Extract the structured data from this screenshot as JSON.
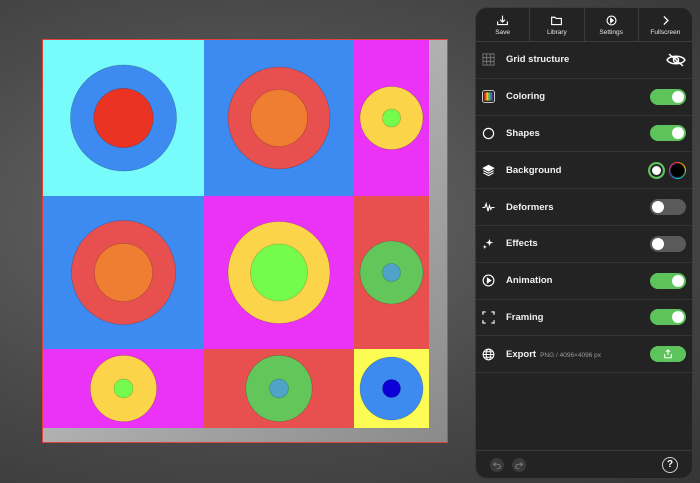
{
  "toolbar": {
    "save_label": "Save",
    "library_label": "Library",
    "settings_label": "Settings",
    "fullscreen_label": "Fullscreen"
  },
  "panel": {
    "grid_structure": {
      "label": "Grid structure",
      "icon": "grid-icon",
      "visible": false
    },
    "coloring": {
      "label": "Coloring",
      "icon": "palette-icon",
      "enabled": true
    },
    "shapes": {
      "label": "Shapes",
      "icon": "circle-icon",
      "enabled": true
    },
    "background": {
      "label": "Background",
      "icon": "layers-icon",
      "swatches": [
        "#ffffff",
        "#000000"
      ]
    },
    "deformers": {
      "label": "Deformers",
      "icon": "waveform-icon",
      "enabled": false
    },
    "effects": {
      "label": "Effects",
      "icon": "sparkles-icon",
      "enabled": false
    },
    "animation": {
      "label": "Animation",
      "icon": "play-icon",
      "enabled": true
    },
    "framing": {
      "label": "Framing",
      "icon": "frame-corners-icon",
      "enabled": true
    },
    "export": {
      "label": "Export",
      "format": "PNG / 4096×4096 px",
      "icon": "globe-icon"
    },
    "help_label": "?"
  },
  "artwork": {
    "cells": [
      {
        "bg": "#77fbfb",
        "outer": "#3d8bf0",
        "inner": "#ea3323",
        "outer_r": 0.68,
        "inner_r": 0.38
      },
      {
        "bg": "#3d8bf0",
        "outer": "#e8504f",
        "inner": "#ef7d32",
        "outer_r": 0.68,
        "inner_r": 0.38
      },
      {
        "bg": "#ea33f7",
        "outer": "#fbd44a",
        "inner": "#75fb4c",
        "outer_r": 0.84,
        "inner_r": 0.24
      },
      {
        "bg": "#3d8bf0",
        "outer": "#e8504f",
        "inner": "#ef7d32",
        "outer_r": 0.68,
        "inner_r": 0.38
      },
      {
        "bg": "#ea33f7",
        "outer": "#fbd44a",
        "inner": "#75fb4c",
        "outer_r": 0.68,
        "inner_r": 0.38
      },
      {
        "bg": "#e8504f",
        "outer": "#63c65a",
        "inner": "#4fa3c9",
        "outer_r": 0.84,
        "inner_r": 0.24
      },
      {
        "bg": "#ea33f7",
        "outer": "#fbd44a",
        "inner": "#75fb4c",
        "outer_r": 0.84,
        "inner_r": 0.24
      },
      {
        "bg": "#e8504f",
        "outer": "#63c65a",
        "inner": "#4fa3c9",
        "outer_r": 0.84,
        "inner_r": 0.24
      },
      {
        "bg": "#fdfc54",
        "outer": "#3d8bf0",
        "inner": "#0b00d6",
        "outer_r": 0.84,
        "inner_r": 0.24
      }
    ]
  }
}
